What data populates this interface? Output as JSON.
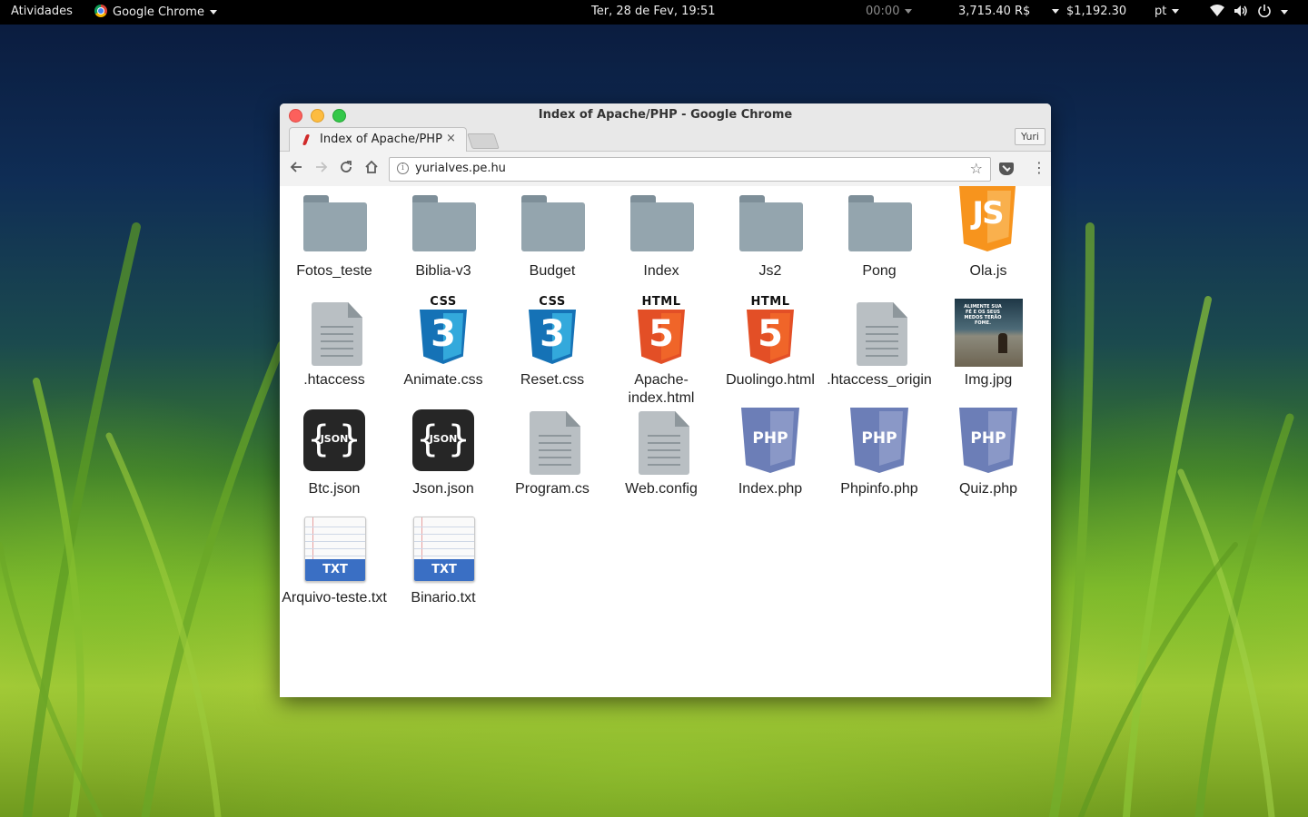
{
  "topbar": {
    "activities": "Atividades",
    "app_name": "Google Chrome",
    "datetime": "Ter, 28 de Fev, 19:51",
    "timer": "00:00",
    "balance_brl": "3,715.40 R$",
    "balance_usd": "$1,192.30",
    "keyboard_layout": "pt"
  },
  "window": {
    "title": "Index of Apache/PHP - Google Chrome",
    "tab_title": "Index of Apache/PHP",
    "tab_close": "×",
    "profile": "Yuri",
    "url": "yurialves.pe.hu"
  },
  "files": [
    {
      "name": "Fotos_teste",
      "type": "folder"
    },
    {
      "name": "Biblia-v3",
      "type": "folder"
    },
    {
      "name": "Budget",
      "type": "folder"
    },
    {
      "name": "Index",
      "type": "folder"
    },
    {
      "name": "Js2",
      "type": "folder"
    },
    {
      "name": "Pong",
      "type": "folder"
    },
    {
      "name": "Ola.js",
      "type": "js",
      "icon_text": "JS"
    },
    {
      "name": ".htaccess",
      "type": "doc"
    },
    {
      "name": "Animate.css",
      "type": "css",
      "icon_label": "CSS",
      "icon_text": "3"
    },
    {
      "name": "Reset.css",
      "type": "css",
      "icon_label": "CSS",
      "icon_text": "3"
    },
    {
      "name": "Apache-index.html",
      "type": "html",
      "icon_label": "HTML",
      "icon_text": "5"
    },
    {
      "name": "Duolingo.html",
      "type": "html",
      "icon_label": "HTML",
      "icon_text": "5"
    },
    {
      "name": ".htaccess_origin",
      "type": "doc"
    },
    {
      "name": "Img.jpg",
      "type": "image",
      "icon_text": "ALIMENTE SUA FÉ E OS SEUS MEDOS TERÃO FOME."
    },
    {
      "name": "Btc.json",
      "type": "json",
      "icon_text": "JSON"
    },
    {
      "name": "Json.json",
      "type": "json",
      "icon_text": "JSON"
    },
    {
      "name": "Program.cs",
      "type": "doc"
    },
    {
      "name": "Web.config",
      "type": "doc"
    },
    {
      "name": "Index.php",
      "type": "php",
      "icon_text": "PHP"
    },
    {
      "name": "Phpinfo.php",
      "type": "php",
      "icon_text": "PHP"
    },
    {
      "name": "Quiz.php",
      "type": "php",
      "icon_text": "PHP"
    },
    {
      "name": "Arquivo-teste.txt",
      "type": "txt",
      "icon_text": "TXT"
    },
    {
      "name": "Binario.txt",
      "type": "txt",
      "icon_text": "TXT"
    }
  ]
}
